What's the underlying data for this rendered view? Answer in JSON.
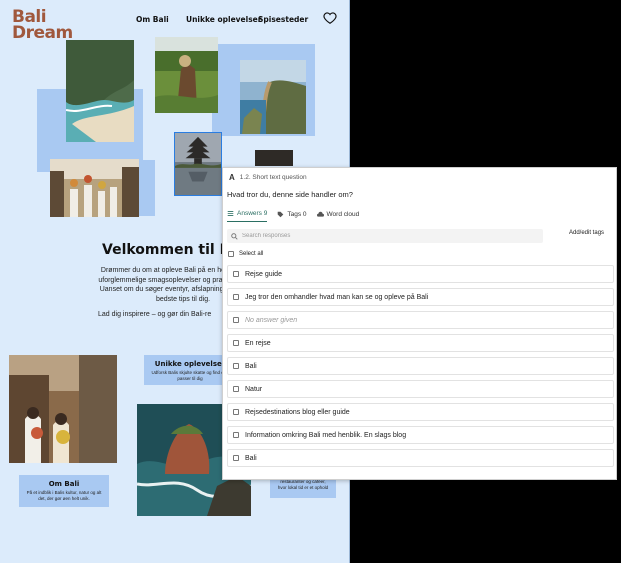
{
  "site": {
    "logo_line1": "Bali",
    "logo_line2": "Dream",
    "nav": [
      "Om Bali",
      "Unikke oplevelser",
      "Spisesteder"
    ],
    "welcome_heading": "Velkommen til Bali D",
    "intro_lines": [
      "Drømmer du om at opleve Bali på en helt særlig måd",
      "uforglemmelige smagsoplevelser og praktiske rejseråd",
      "Uanset om du søger eventyr, afslapning eller kulinaris",
      "bedste tips til dig."
    ],
    "intro_2": "Lad dig inspirere – og gør din Bali-re",
    "cards": {
      "unikke_title": "Unikke oplevelser",
      "unikke_desc": "Udforsk Balis skjulte skatte og find eve passer til dig",
      "om_bali_title": "Om Bali",
      "om_bali_desc": "På et indblik i Balis kultur, natur og alt det, der gør øen helt unik.",
      "spise_desc": "restauranter og caféer, hvor lokal tid er et ophold"
    }
  },
  "panel": {
    "question_id": "1.2. Short text question",
    "question_text": "Hvad tror du, denne side handler om?",
    "tabs": {
      "answers": "Answers 9",
      "tags": "Tags 0",
      "word_cloud": "Word cloud"
    },
    "search_placeholder": "Search responses",
    "add_edit_tags": "Add/edit tags",
    "select_all": "Select all",
    "answers": [
      "Rejse guide",
      "Jeg tror den omhandler hvad man kan se og opleve på Bali",
      "No answer given",
      "En rejse",
      "Bali",
      "Natur",
      "Rejsedestinations blog eller guide",
      "Information omkring Bali med henblik. En slags blog",
      "Bali"
    ]
  },
  "colors": {
    "site_bg": "#dcebfb",
    "block_blue": "#a9c9f2",
    "logo": "#a0583d",
    "tab_active": "#2b6f63"
  }
}
